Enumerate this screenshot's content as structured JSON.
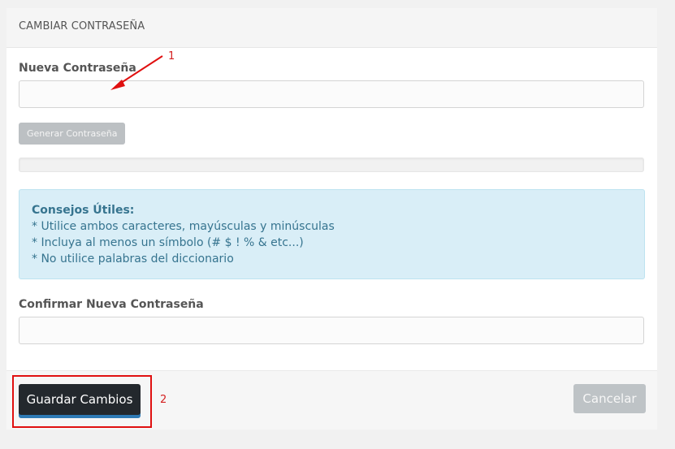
{
  "panel": {
    "title": "CAMBIAR CONTRASEÑA"
  },
  "new_password": {
    "label": "Nueva Contraseña",
    "value": "",
    "placeholder": ""
  },
  "generate_button": {
    "label": "Generar Contraseña"
  },
  "strength": {
    "fill_percent": 0
  },
  "tips": {
    "title": "Consejos Útiles:",
    "lines": [
      "* Utilice ambos caracteres, mayúsculas y minúsculas",
      "* Incluya al menos un símbolo (# $ ! % & etc...)",
      "* No utilice palabras del diccionario"
    ]
  },
  "confirm_password": {
    "label": "Confirmar Nueva Contraseña",
    "value": "",
    "placeholder": ""
  },
  "footer": {
    "save_label": "Guardar Cambios",
    "cancel_label": "Cancelar"
  },
  "annotations": {
    "marker_1": "1",
    "marker_2": "2"
  },
  "colors": {
    "accent": "#2e7ab5",
    "annotation": "#e01010",
    "tips_background": "#d9eef7",
    "tips_text": "#36748f"
  }
}
